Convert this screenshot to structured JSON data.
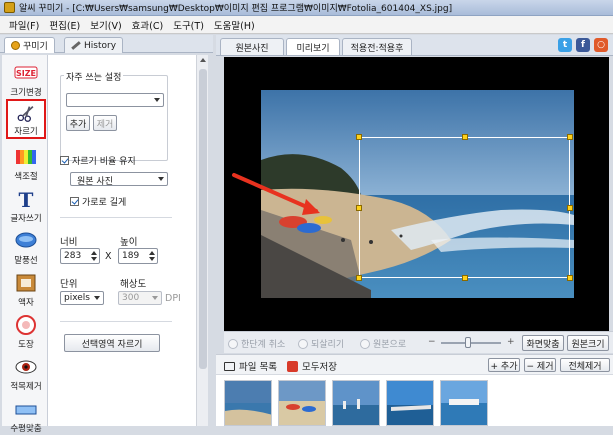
{
  "window": {
    "title": "알씨 꾸미기 - [C:₩Users₩samsung₩Desktop₩이미지 편집 프로그램₩이미지₩Fotolia_601404_XS.jpg]"
  },
  "menu": [
    "파일(F)",
    "편집(E)",
    "보기(V)",
    "효과(C)",
    "도구(T)",
    "도움말(H)"
  ],
  "left_tabs": {
    "decorate": "꾸미기",
    "history": "History"
  },
  "tools": [
    {
      "label": "크기변경",
      "icon": "size-icon"
    },
    {
      "label": "자르기",
      "icon": "scissors-icon",
      "selected": true
    },
    {
      "label": "색조절",
      "icon": "color-palette-icon"
    },
    {
      "label": "글자쓰기",
      "icon": "text-t-icon"
    },
    {
      "label": "말풍선",
      "icon": "speech-balloon-icon"
    },
    {
      "label": "액자",
      "icon": "frame-icon"
    },
    {
      "label": "도장",
      "icon": "stamp-icon"
    },
    {
      "label": "적목제거",
      "icon": "red-eye-icon"
    },
    {
      "label": "수평맞춤",
      "icon": "level-icon"
    }
  ],
  "crop_panel": {
    "presets_title": "자주 쓰는 설정",
    "presets_value": "",
    "add_button": "추가",
    "remove_button": "제거",
    "keep_ratio_label": "자르기 비율 유지",
    "ratio_value": "원본 사진",
    "landscape_label": "가로로 길게",
    "width_label": "너비",
    "height_label": "높이",
    "width_value": "283",
    "times": "X",
    "height_value": "189",
    "unit_label": "단위",
    "resolution_label": "해상도",
    "unit_value": "pixels",
    "resolution_value": "300",
    "dpi": "DPI",
    "crop_button": "선택영역 자르기"
  },
  "view_tabs": [
    "원본사진",
    "미리보기",
    "적용전:적용후"
  ],
  "social": [
    {
      "name": "twitter-icon",
      "letter": "t",
      "color": "#3aa0e6"
    },
    {
      "name": "facebook-icon",
      "letter": "f",
      "color": "#3b5998"
    },
    {
      "name": "ring-icon",
      "letter": "○",
      "color": "#e05a2a"
    }
  ],
  "nav": {
    "undo": "한단계 취소",
    "redo": "되살리기",
    "original": "원본으로",
    "fit": "화면맞춤",
    "original_size": "원본크기",
    "minus": "−",
    "plus": "+"
  },
  "files": {
    "title": "파일 목록",
    "save_all": "모두저장",
    "add": "+ 추가",
    "remove": "− 제거",
    "remove_all": "전체제거"
  },
  "colors": {
    "selection_handle": "#ffd21a",
    "highlight_border": "#e01818",
    "canvas_bg": "#000000"
  }
}
